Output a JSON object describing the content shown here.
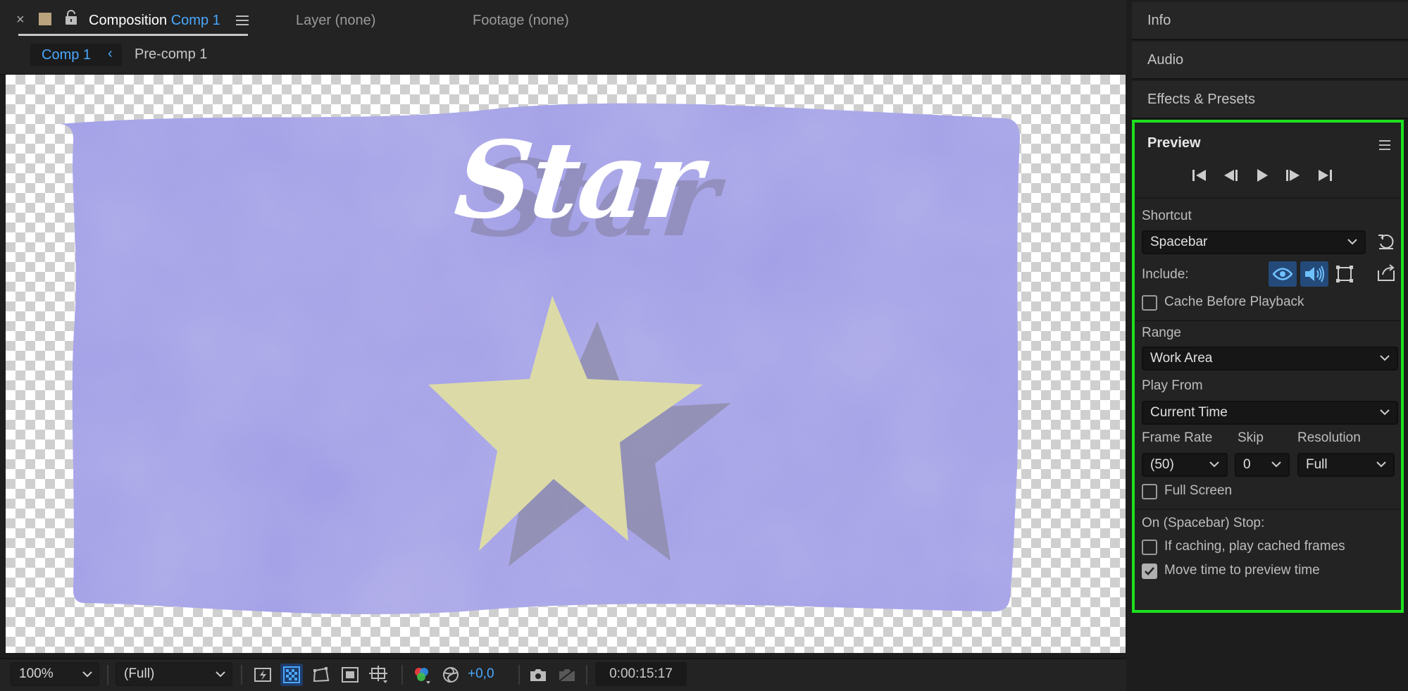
{
  "top_tabs": {
    "composition_prefix": "Composition",
    "composition_name": "Comp 1",
    "layer_tab": "Layer (none)",
    "footage_tab": "Footage (none)"
  },
  "sub_tabs": {
    "active": "Comp 1",
    "other": "Pre-comp 1"
  },
  "canvas": {
    "title_text": "Star"
  },
  "bottom_bar": {
    "zoom": "100%",
    "resolution": "(Full)",
    "exposure": "+0,0",
    "timecode": "0:00:15:17"
  },
  "right_panel": {
    "info": "Info",
    "audio": "Audio",
    "effects": "Effects & Presets"
  },
  "preview": {
    "title": "Preview",
    "shortcut_label": "Shortcut",
    "shortcut_value": "Spacebar",
    "include_label": "Include:",
    "cache_before_playback": "Cache Before Playback",
    "range_label": "Range",
    "range_value": "Work Area",
    "play_from_label": "Play From",
    "play_from_value": "Current Time",
    "frame_rate_label": "Frame Rate",
    "frame_rate_value": "(50)",
    "skip_label": "Skip",
    "skip_value": "0",
    "resolution_label": "Resolution",
    "resolution_value": "Full",
    "full_screen": "Full Screen",
    "stop_label": "On (Spacebar) Stop:",
    "if_caching": "If caching, play cached frames",
    "move_time": "Move time to preview time",
    "move_time_checked": true
  },
  "colors": {
    "accent_blue": "#4aa8ff",
    "highlight_green": "#1ee01e",
    "card_purple": "#a6a3ea",
    "star_yellow": "#dcdba8"
  }
}
